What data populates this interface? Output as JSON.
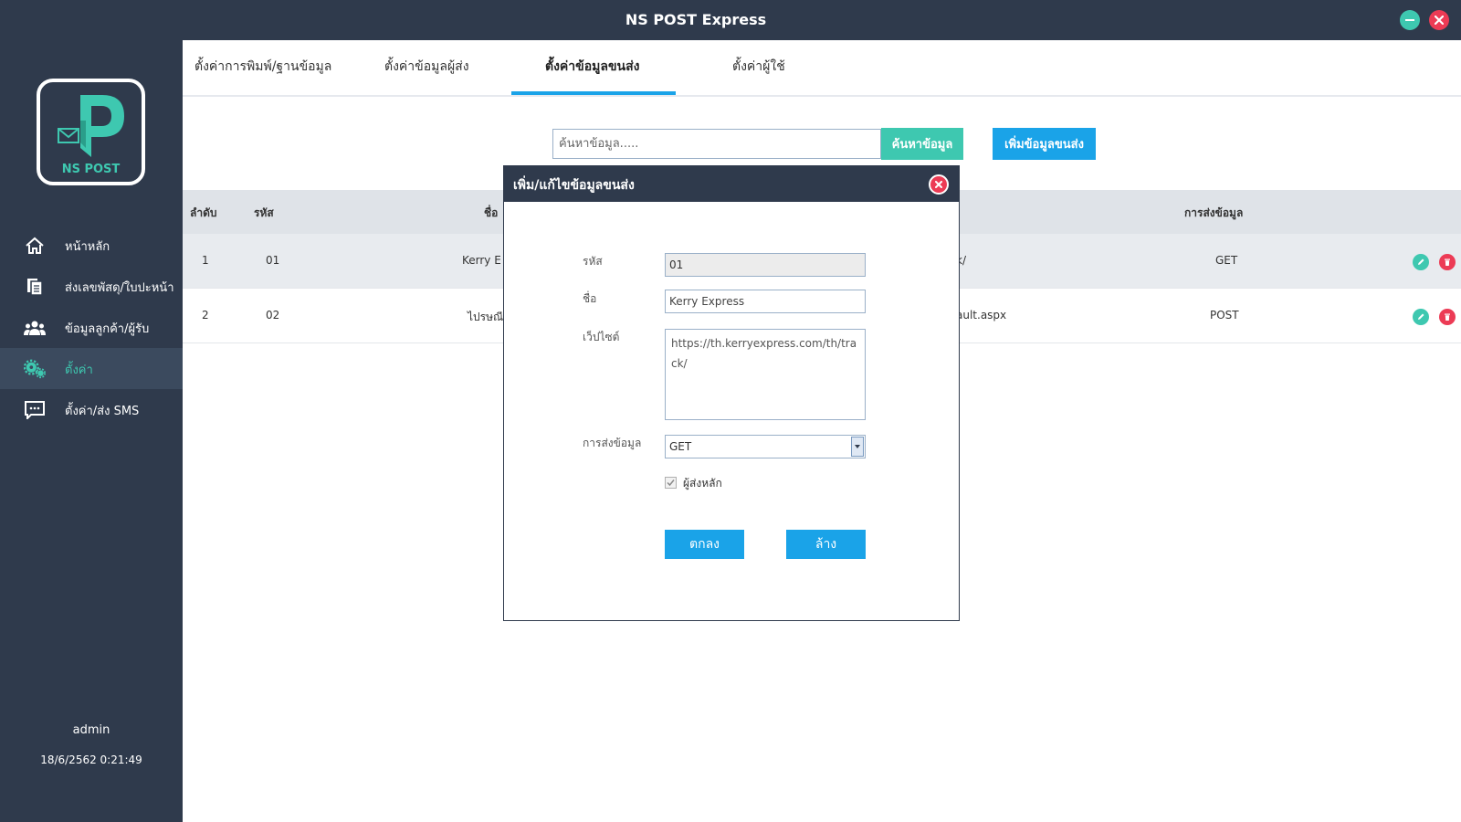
{
  "window": {
    "title": "NS POST Express"
  },
  "sidebar": {
    "logo_text": "NS POST",
    "items": [
      {
        "label": "หน้าหลัก",
        "icon": "home-icon"
      },
      {
        "label": "ส่งเลขพัสดุ/ใบปะหน้า",
        "icon": "document-icon"
      },
      {
        "label": "ข้อมูลลูกค้า/ผู้รับ",
        "icon": "users-icon"
      },
      {
        "label": "ตั้งค่า",
        "icon": "gear-icon",
        "active": true
      },
      {
        "label": "ตั้งค่า/ส่ง SMS",
        "icon": "chat-icon"
      }
    ],
    "user": "admin",
    "datetime": "18/6/2562 0:21:49"
  },
  "tabs": [
    {
      "label": "ตั้งค่าการพิมพ์/ฐานข้อมูล"
    },
    {
      "label": "ตั้งค่าข้อมูลผู้ส่ง"
    },
    {
      "label": "ตั้งค่าข้อมูลขนส่ง",
      "active": true
    },
    {
      "label": "ตั้งค่าผู้ใช้"
    }
  ],
  "toolbar": {
    "search_placeholder": "ค้นหาข้อมูล.....",
    "search_label": "ค้นหาข้อมูล",
    "add_label": "เพิ่มข้อมูลขนส่ง"
  },
  "table": {
    "headers": {
      "no": "ลำดับ",
      "code": "รหัส",
      "name": "ชื่อ",
      "method": "การส่งข้อมูล"
    },
    "rows": [
      {
        "no": "1",
        "code": "01",
        "name": "Kerry E",
        "url": "k/",
        "method": "GET"
      },
      {
        "no": "2",
        "code": "02",
        "name": "ไปรษณี",
        "url": "ault.aspx",
        "method": "POST"
      }
    ]
  },
  "modal": {
    "title": "เพิ่ม/แก้ไขข้อมูลขนส่ง",
    "code_label": "รหัส",
    "code_value": "01",
    "name_label": "ชื่อ",
    "name_value": "Kerry Express",
    "website_label": "เว็ปไซต์",
    "website_value": "https://th.kerryexpress.com/th/track/",
    "method_label": "การส่งข้อมูล",
    "method_value": "GET",
    "main_sender_label": "ผู้ส่งหลัก",
    "main_sender_checked": true,
    "ok_label": "ตกลง",
    "clear_label": "ล้าง"
  },
  "colors": {
    "dark": "#2f3a4c",
    "accent_teal": "#3ec8b0",
    "accent_blue": "#1aa3e8",
    "danger": "#ec3b55"
  }
}
